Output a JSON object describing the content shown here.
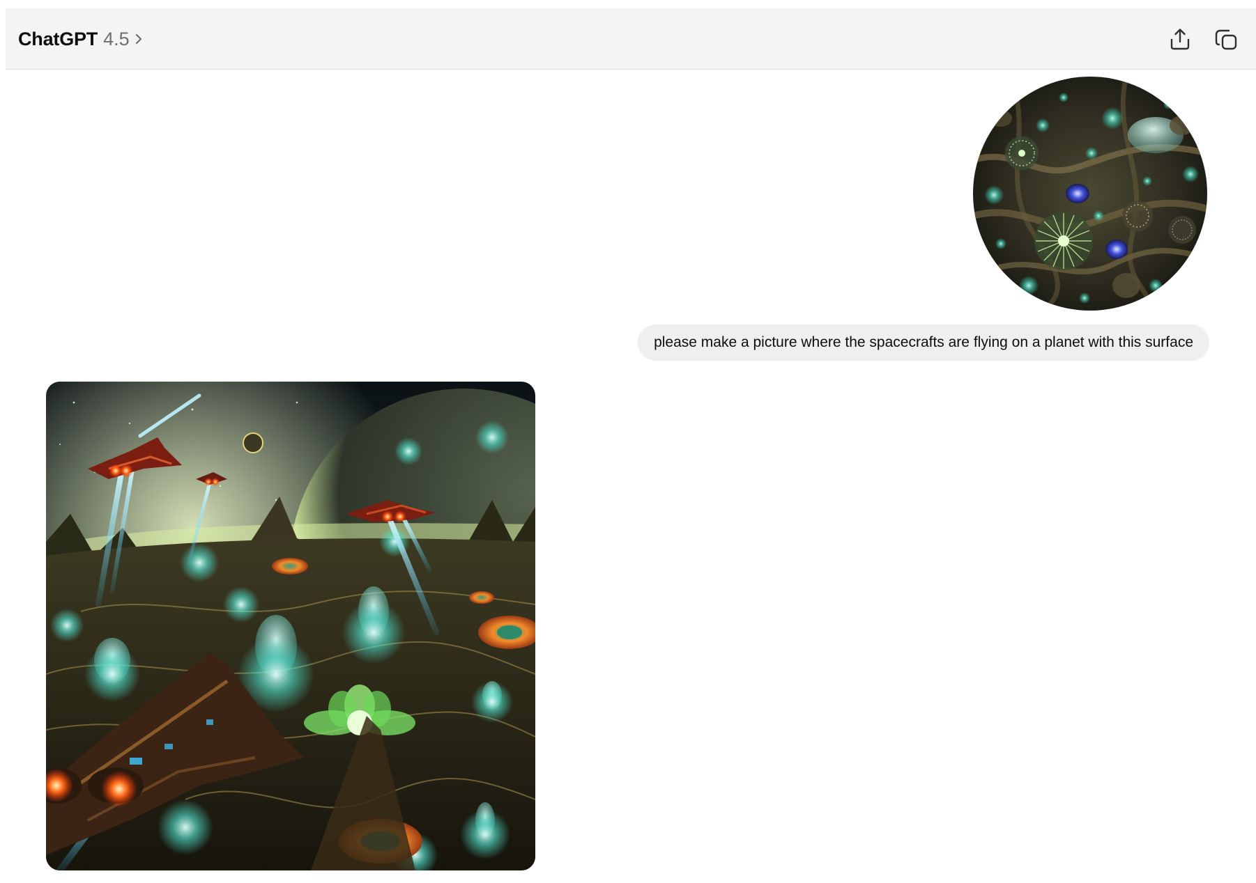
{
  "header": {
    "app_name": "ChatGPT",
    "model_version": "4.5",
    "share_icon": "share-upload-icon",
    "new_window_icon": "new-window-icon",
    "background": "#f4f4f3"
  },
  "conversation": {
    "user_message": {
      "attachment_icon": "surface-texture-image",
      "text": "please make a picture where the spacecrafts are flying on a planet with this surface",
      "bubble_color": "#efefef"
    },
    "assistant_message": {
      "image_icon": "generated-spacecraft-planet-image"
    }
  }
}
